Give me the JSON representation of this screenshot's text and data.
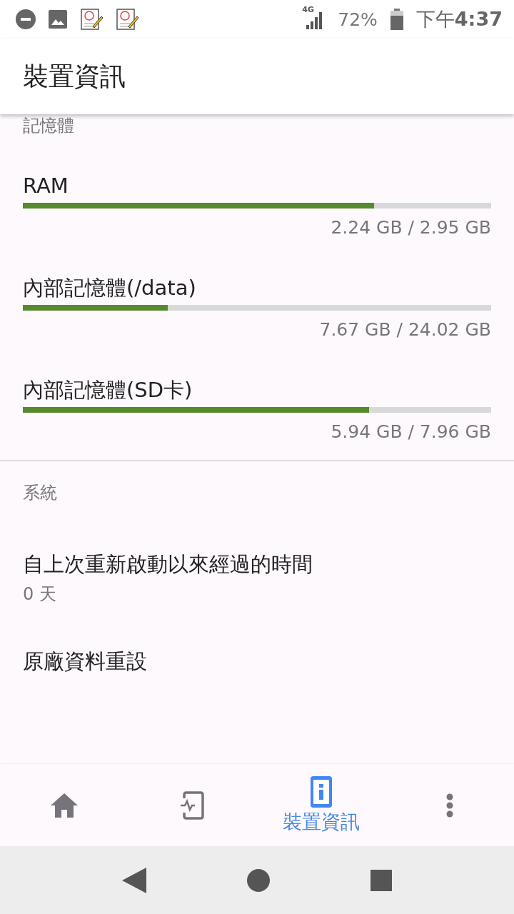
{
  "status_bar": {
    "time": "下午**4:37**",
    "network": "4G",
    "battery": "72%"
  },
  "app_bar": {
    "title": "裝置資訊"
  },
  "sections": [
    {
      "header": "記憶體",
      "items": [
        {
          "kind": "meter",
          "title": "RAM",
          "level": 0.75,
          "reading": "2.24 GB / 2.95 GB"
        },
        {
          "kind": "meter",
          "title": "內部記憶體(/data)",
          "level": 0.31,
          "reading": "7.67 GB / 24.02 GB"
        },
        {
          "kind": "meter",
          "title": "內部記憶體(SD卡)",
          "level": 0.74,
          "reading": "5.94 GB / 7.96 GB"
        }
      ]
    },
    {
      "header": "系統",
      "items": [
        {
          "kind": "text",
          "title": "自上次重新啟動以來經過的時間",
          "value": "0 天"
        },
        {
          "kind": "text",
          "title": "原廠資料重設"
        }
      ]
    }
  ],
  "bottom_nav": [
    {
      "kind": "home",
      "selected": false
    },
    {
      "kind": "monitor",
      "selected": false
    },
    {
      "kind": "info",
      "label": "裝置資訊",
      "selected": true
    },
    {
      "kind": "more",
      "selected": false
    }
  ]
}
